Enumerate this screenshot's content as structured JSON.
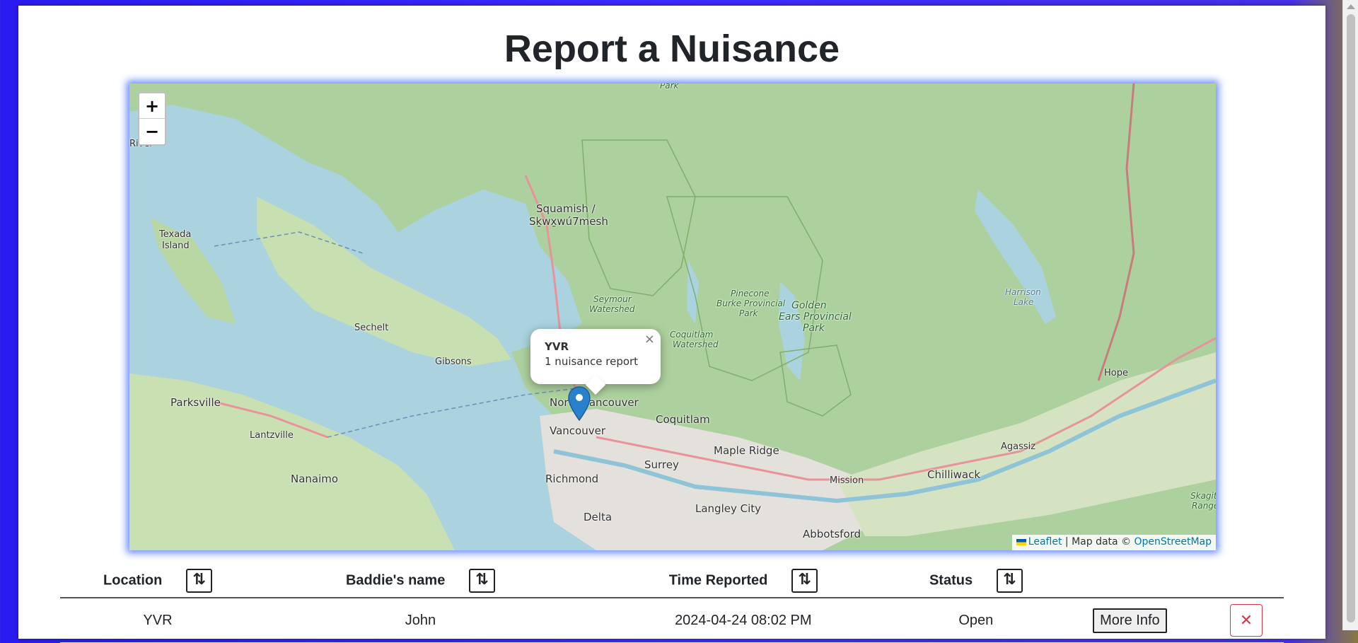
{
  "page": {
    "title": "Report a Nuisance"
  },
  "map": {
    "zoom_in_label": "+",
    "zoom_out_label": "−",
    "popup": {
      "title": "YVR",
      "body": "1 nuisance report",
      "close_label": "×"
    },
    "attribution": {
      "leaflet": "Leaflet",
      "separator": " | Map data © ",
      "osm": "OpenStreetMap"
    },
    "places": {
      "park": "Park",
      "river": "River",
      "squamish": "Squamish /",
      "squamish2": "Sḵwx̱wú7mesh",
      "texada": "Texada",
      "texada2": "Island",
      "sechelt": "Sechelt",
      "gibsons": "Gibsons",
      "parksville": "Parksville",
      "lantzville": "Lantzville",
      "nanaimo": "Nanaimo",
      "north_vancouver": "North Vancouver",
      "vancouver": "Vancouver",
      "coquitlam": "Coquitlam",
      "maple_ridge": "Maple Ridge",
      "richmond": "Richmond",
      "surrey": "Surrey",
      "delta": "Delta",
      "langley": "Langley City",
      "abbotsford": "Abbotsford",
      "mission": "Mission",
      "chilliwack": "Chilliwack",
      "agassiz": "Agassiz",
      "hope": "Hope",
      "harrison": "Harrison",
      "harrison2": "Lake",
      "seymour": "Seymour",
      "seymour2": "Watershed",
      "pinecone": "Pinecone",
      "pinecone2": "Burke Provincial",
      "pinecone3": "Park",
      "coquitlam_ws": "Coquitlam",
      "coquitlam_ws2": "Watershed",
      "golden": "Golden",
      "golden2": "Ears Provincial",
      "golden3": "Park",
      "skagit": "Skagit",
      "skagit2": "Range"
    }
  },
  "table": {
    "headers": {
      "location": "Location",
      "baddie": "Baddie's name",
      "time": "Time Reported",
      "status": "Status",
      "sort_icon": "⇅"
    },
    "rows": [
      {
        "location": "YVR",
        "baddie": "John",
        "time": "2024-04-24 08:02 PM",
        "status": "Open",
        "more_info": "More Info",
        "delete": "✕"
      }
    ]
  },
  "colors": {
    "land": "#d9e8c6",
    "forest": "#add19e",
    "water": "#aad3df",
    "urban": "#e0dfdf",
    "delete": "#dc3545",
    "link": "#0078a8"
  }
}
